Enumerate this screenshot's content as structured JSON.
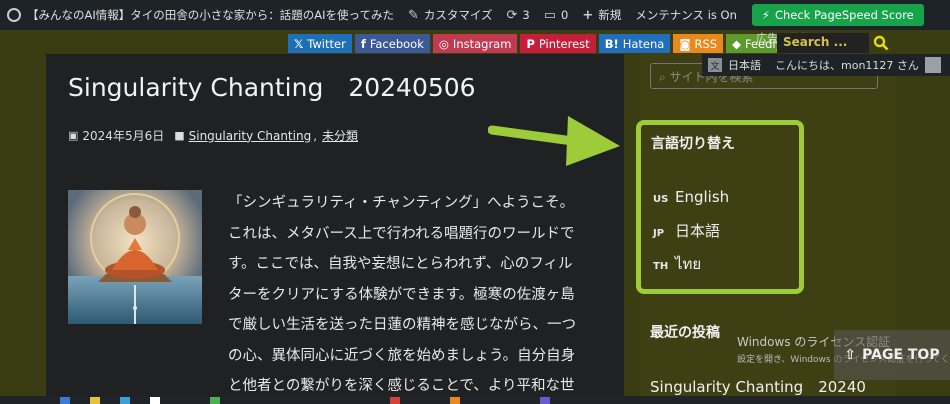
{
  "adminbar": {
    "site_label": "【みんなのAI情報】タイの田舎の小さな家から：話題のAIを使ってみた",
    "customize_label": "カスタマイズ",
    "updates_count": "3",
    "comments_count": "0",
    "new_label": "新規",
    "maintenance_label": "メンテナンス is On",
    "pagespeed_label": "Check PageSpeed Score"
  },
  "social": {
    "items": [
      {
        "label": "Twitter",
        "glyph": "𝕏",
        "color": "#1d6fb8"
      },
      {
        "label": "Facebook",
        "glyph": "f",
        "color": "#3b5998"
      },
      {
        "label": "Instagram",
        "glyph": "◎",
        "color": "#c13a52"
      },
      {
        "label": "Pinterest",
        "glyph": "P",
        "color": "#c41e3a"
      },
      {
        "label": "Hatena",
        "glyph": "B!",
        "color": "#1f6fbd"
      },
      {
        "label": "RSS",
        "glyph": "◙",
        "color": "#e8891e"
      },
      {
        "label": "Feedly",
        "glyph": "◆",
        "color": "#5c9a2e"
      }
    ]
  },
  "ad_state": "広告の状態",
  "search": {
    "placeholder": "Search ..."
  },
  "gtranslate": {
    "lang": "日本語",
    "greeting": "こんにちは、mon1127 さん"
  },
  "post": {
    "title": "Singularity Chanting　20240506",
    "date": "2024年5月6日",
    "category1": "Singularity Chanting",
    "separator": ",",
    "category2": "未分類",
    "body_lines": [
      "「シンギュラリティ・チャンティング」へようこそ。",
      "これは、メタバース上で行われる唱題行のワールドで",
      "す。ここでは、自我や妄想にとらわれず、心のフィル",
      "ターをクリアにする体験ができます。極寒の佐渡ヶ島",
      "で厳しい生活を送った日蓮の精神を感じながら、一つ",
      "の心、異体同心に近づく旅を始めましょう。自分自身",
      "と他者との繋がりを深く感じることで、より平和な世"
    ]
  },
  "sidebar": {
    "search_placeholder": "サイト内を検索",
    "lang_title": "言語切り替え",
    "langs": [
      {
        "code": "US",
        "name": "English"
      },
      {
        "code": "JP",
        "name": "日本語"
      },
      {
        "code": "TH",
        "name": "ไทย"
      }
    ],
    "recent_title": "最近の投稿",
    "recent_post": "Singularity Chanting　20240"
  },
  "windows": {
    "line1": "Windows のライセンス認証",
    "line2": "設定を開き、Windows のライセンス認証を行ってください"
  },
  "pagetop": "PAGE TOP",
  "colors": {
    "accent_green": "#9ccc3a",
    "pagespeed_green": "#16a34a",
    "search_yellow": "#d4c24b"
  }
}
